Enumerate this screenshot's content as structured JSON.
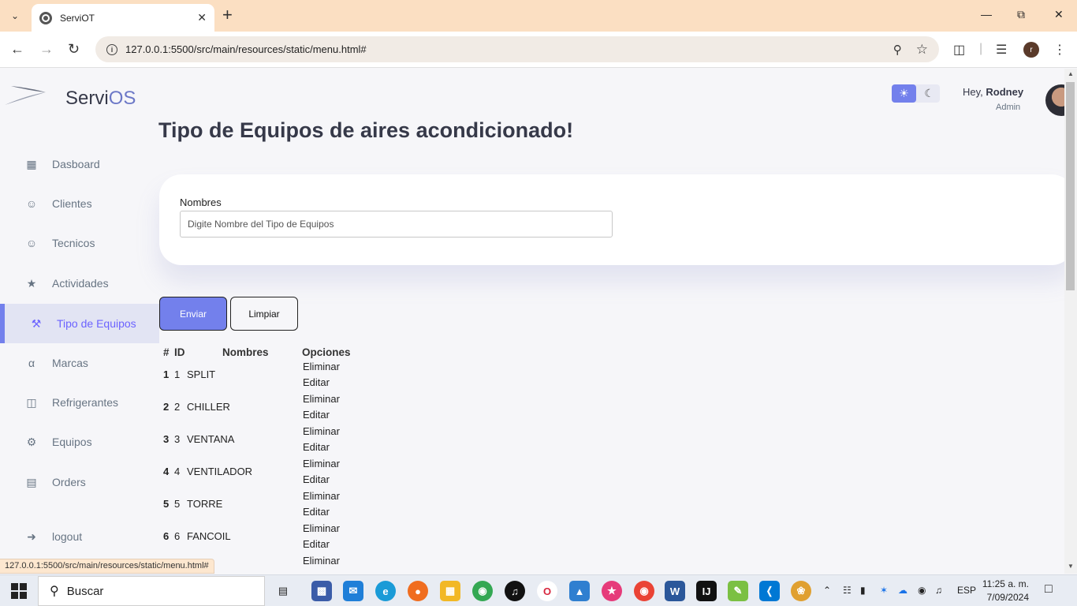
{
  "browser": {
    "tab_title": "ServiOT",
    "url": "127.0.0.1:5500/src/main/resources/static/menu.html#",
    "profile_initial": "r",
    "status_url": "127.0.0.1:5500/src/main/resources/static/menu.html#"
  },
  "app": {
    "brand_prefix": "Servi",
    "brand_suffix": "OS",
    "page_title": "Tipo de Equipos de aires acondicionado!",
    "user_greeting": "Hey,",
    "user_name": "Rodney",
    "user_role": "Admin"
  },
  "sidebar": {
    "items": [
      {
        "label": "Dasboard",
        "icon": "grid-icon"
      },
      {
        "label": "Clientes",
        "icon": "person-icon"
      },
      {
        "label": "Tecnicos",
        "icon": "person-icon"
      },
      {
        "label": "Actividades",
        "icon": "ticket-icon"
      },
      {
        "label": "Tipo de Equipos",
        "icon": "tools-icon",
        "active": true
      },
      {
        "label": "Marcas",
        "icon": "font-icon"
      },
      {
        "label": "Refrigerantes",
        "icon": "tank-icon"
      },
      {
        "label": "Equipos",
        "icon": "gear-icon"
      },
      {
        "label": "Orders",
        "icon": "receipt-icon"
      },
      {
        "label": "logout",
        "icon": "logout-icon"
      }
    ]
  },
  "form": {
    "name_label": "Nombres",
    "name_placeholder": "Digite Nombre del Tipo de Equipos",
    "name_value": "",
    "send_label": "Enviar",
    "clear_label": "Limpiar"
  },
  "table": {
    "headers": [
      "#",
      "ID",
      "Nombres",
      "Opciones"
    ],
    "delete_label": "Eliminar",
    "edit_label": "Editar",
    "rows": [
      {
        "n": "1",
        "id": "1",
        "name": "SPLIT"
      },
      {
        "n": "2",
        "id": "2",
        "name": "CHILLER"
      },
      {
        "n": "3",
        "id": "3",
        "name": "VENTANA"
      },
      {
        "n": "4",
        "id": "4",
        "name": "VENTILADOR"
      },
      {
        "n": "5",
        "id": "5",
        "name": "TORRE"
      },
      {
        "n": "6",
        "id": "6",
        "name": "FANCOIL"
      }
    ]
  },
  "taskbar": {
    "search_label": "Buscar",
    "lang": "ESP",
    "time": "11:25 a. m.",
    "date": "7/09/2024"
  },
  "colors": {
    "accent": "#7380ec",
    "active_bg": "#e2e4f3",
    "text_dark": "#363949",
    "text_muted": "#677483"
  }
}
